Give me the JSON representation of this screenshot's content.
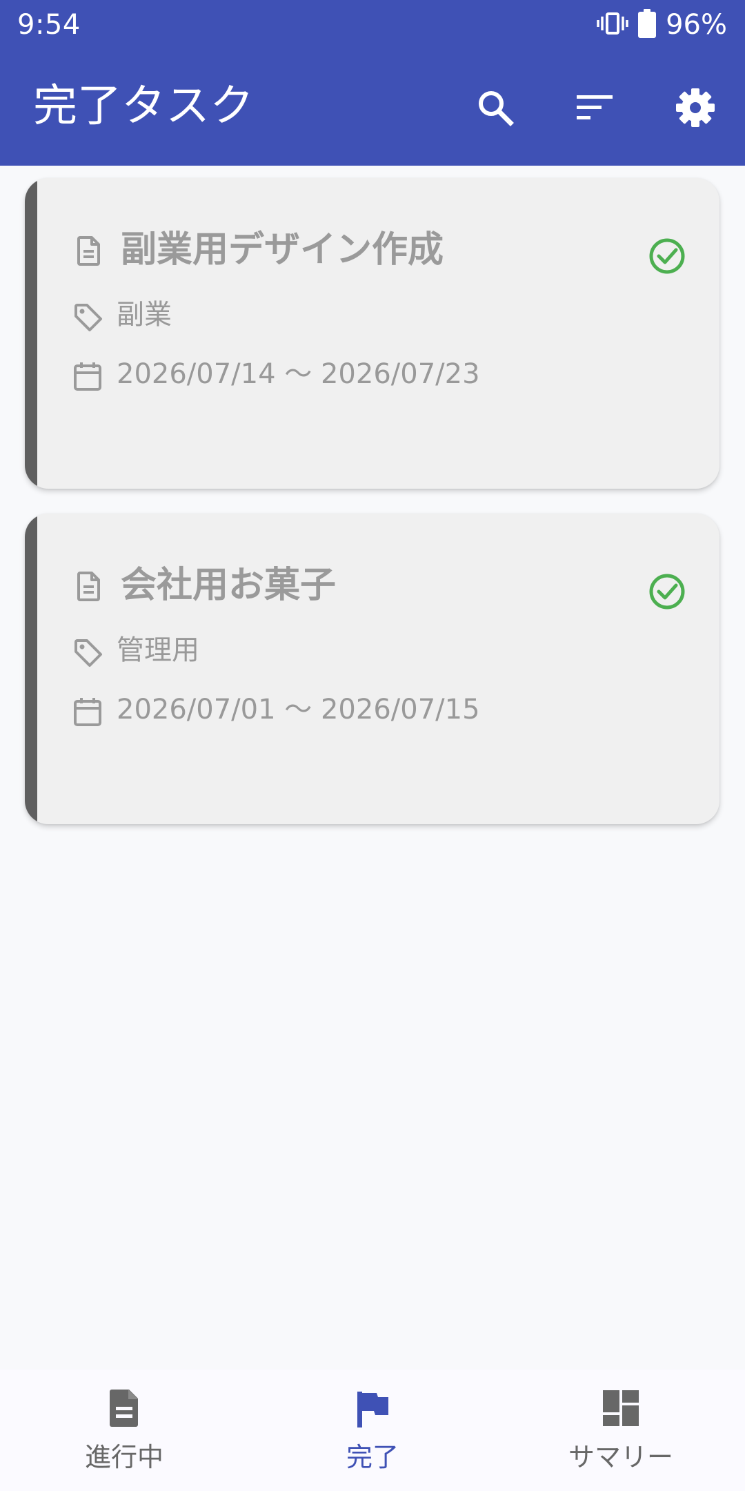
{
  "status_bar": {
    "time": "9:54",
    "battery_percent": "96%",
    "icons": [
      "vibrate-icon",
      "battery-icon"
    ]
  },
  "app_bar": {
    "title": "完了タスク",
    "actions": [
      "search-icon",
      "sort-icon",
      "settings-icon"
    ]
  },
  "tasks": [
    {
      "title": "副業用デザイン作成",
      "tag": "副業",
      "date_range": "2026/07/14 〜 2026/07/23",
      "status": "completed"
    },
    {
      "title": "会社用お菓子",
      "tag": "管理用",
      "date_range": "2026/07/01 〜 2026/07/15",
      "status": "completed"
    }
  ],
  "bottom_nav": {
    "items": [
      {
        "label": "進行中",
        "icon": "document-icon",
        "active": false
      },
      {
        "label": "完了",
        "icon": "flag-icon",
        "active": true
      },
      {
        "label": "サマリー",
        "icon": "dashboard-icon",
        "active": false
      }
    ]
  },
  "colors": {
    "primary": "#3f51b5",
    "background": "#f8f9fb",
    "card": "#f0f0f0",
    "accent_bar": "#5f5f5f",
    "success": "#4caf50",
    "muted_text": "#999999"
  }
}
